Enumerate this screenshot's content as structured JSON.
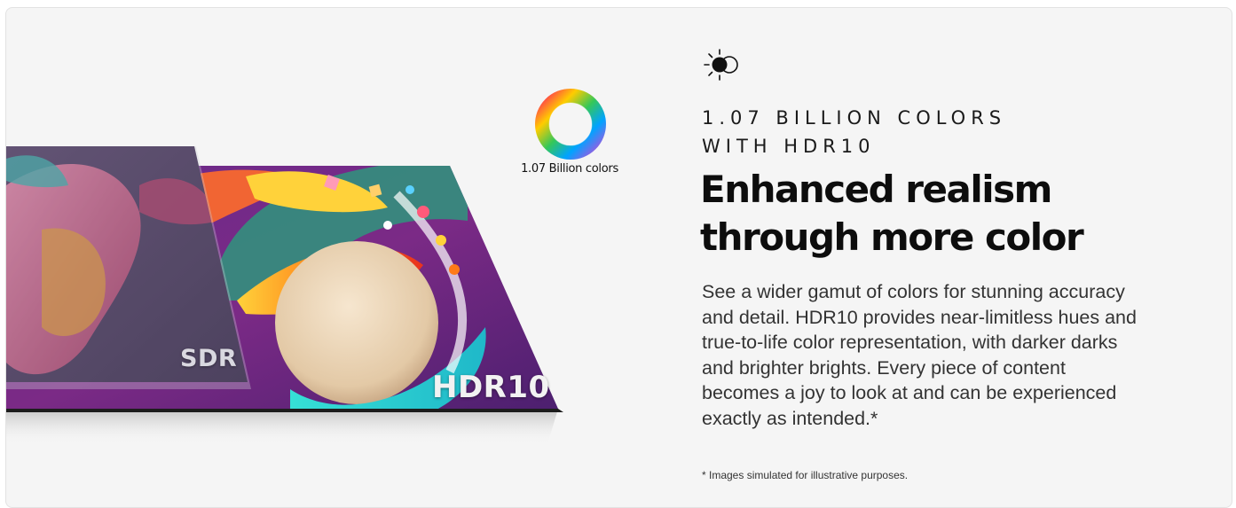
{
  "visual": {
    "color_ring_caption": "1.07 Billion colors",
    "sdr_label": "SDR",
    "hdr_label": "HDR10"
  },
  "feature": {
    "icon": "hdr-contrast-icon",
    "eyebrow_line1": "1.07 BILLION COLORS",
    "eyebrow_line2": "WITH HDR10",
    "headline_line1": "Enhanced realism",
    "headline_line2": "through more color",
    "body": "See a wider gamut of colors for stunning accuracy and detail. HDR10 provides near-limitless hues and true-to-life color representation, with darker darks and brighter brights. Every piece of content becomes a joy to look at and can be experienced exactly as intended.*",
    "footnote": "* Images simulated for illustrative purposes."
  },
  "colors": {
    "background": "#f5f5f5",
    "text_primary": "#0d0d0d",
    "text_body": "#333333"
  }
}
